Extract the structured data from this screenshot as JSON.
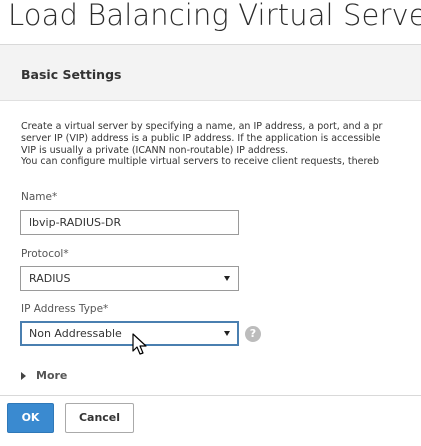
{
  "page_title": "Load Balancing Virtual Server",
  "section": {
    "title": "Basic Settings"
  },
  "description_lines": [
    "Create a virtual server by specifying a name, an IP address, a port, and a pr",
    "server IP (VIP) address is a public IP address. If the application is accessible",
    "VIP is usually a private (ICANN non-routable) IP address.",
    "You can configure multiple virtual servers to receive client requests, thereb"
  ],
  "fields": {
    "name": {
      "label": "Name*",
      "value": "lbvip-RADIUS-DR"
    },
    "protocol": {
      "label": "Protocol*",
      "value": "RADIUS"
    },
    "ip_address_type": {
      "label": "IP Address Type*",
      "value": "Non Addressable"
    }
  },
  "help_icon_glyph": "?",
  "more": {
    "label": "More"
  },
  "buttons": {
    "ok": "OK",
    "cancel": "Cancel"
  },
  "colors": {
    "accent": "#3a8ad0",
    "focus_border": "#4a7fb0",
    "header_bg": "#f3f3f3"
  },
  "icons": {
    "help": "help-circle-icon",
    "caret": "caret-down-icon",
    "expand": "triangle-right-icon",
    "cursor": "mouse-pointer-icon"
  }
}
